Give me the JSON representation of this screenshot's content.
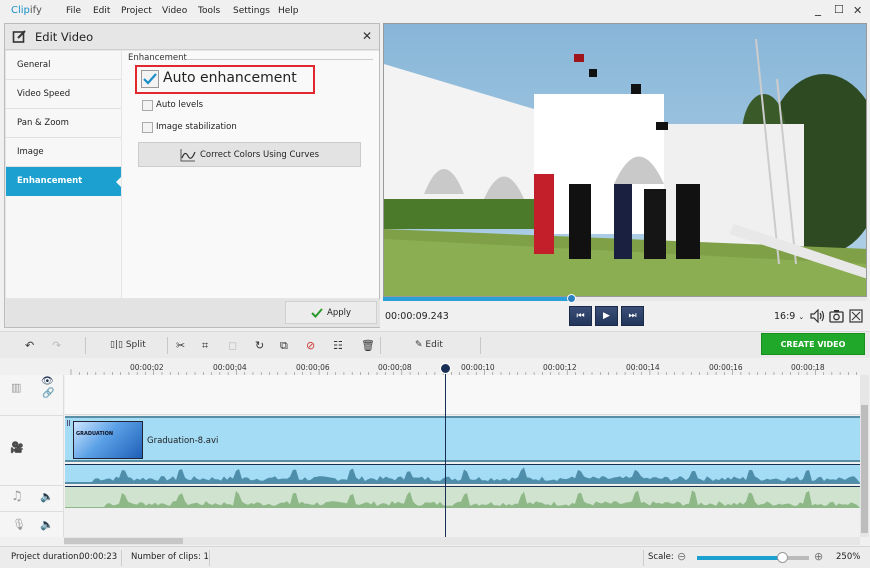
{
  "app": {
    "logo_main": "Clip",
    "logo_rest": "ify"
  },
  "menu": [
    "File",
    "Edit",
    "Project",
    "Video",
    "Tools",
    "Settings",
    "Help"
  ],
  "window_controls": {
    "minimize": "_",
    "maximize": "☐",
    "close": "✕"
  },
  "edit_panel": {
    "title": "Edit Video",
    "close": "✕",
    "sidebar": [
      {
        "label": "General",
        "active": false
      },
      {
        "label": "Video Speed",
        "active": false
      },
      {
        "label": "Pan & Zoom",
        "active": false
      },
      {
        "label": "Image",
        "active": false
      },
      {
        "label": "Enhancement",
        "active": true
      }
    ],
    "section_label": "Enhancement",
    "options": [
      {
        "label": "Auto enhancement",
        "checked": true,
        "highlighted": true
      },
      {
        "label": "Auto levels",
        "checked": false
      },
      {
        "label": "Image stabilization",
        "checked": false
      }
    ],
    "curves_button": "Correct Colors Using Curves",
    "apply_button": "Apply"
  },
  "player": {
    "timecode": "00:00:09.243",
    "progress_fraction": 0.39,
    "aspect_ratio": "16:9",
    "prev_icon": "⏮",
    "play_icon": "▶",
    "next_icon": "⏭"
  },
  "toolbar": {
    "split_label": "Split",
    "edit_label": "Edit",
    "create_video_label": "CREATE VIDEO"
  },
  "timeline": {
    "ticks": [
      "00:00:02",
      "00:00:04",
      "00:00:06",
      "00:00:08",
      "00:00:10",
      "00:00:12",
      "00:00:14",
      "00:00:16",
      "00:00:18"
    ],
    "playhead_time": "00:00:09.243",
    "clip": {
      "name": "Graduation-8.avi",
      "thumb_text": "GRADUATION"
    }
  },
  "status": {
    "duration_label": "Project duration:",
    "duration_value": "00:00:23",
    "clips_label": "Number of clips: 1",
    "scale_label": "Scale:",
    "scale_value": "250%",
    "scale_fraction": 0.77
  },
  "colors": {
    "accent": "#1ba0cf",
    "create": "#1fa82a",
    "highlight": "#e0282e",
    "playhead": "#1a2f55"
  }
}
